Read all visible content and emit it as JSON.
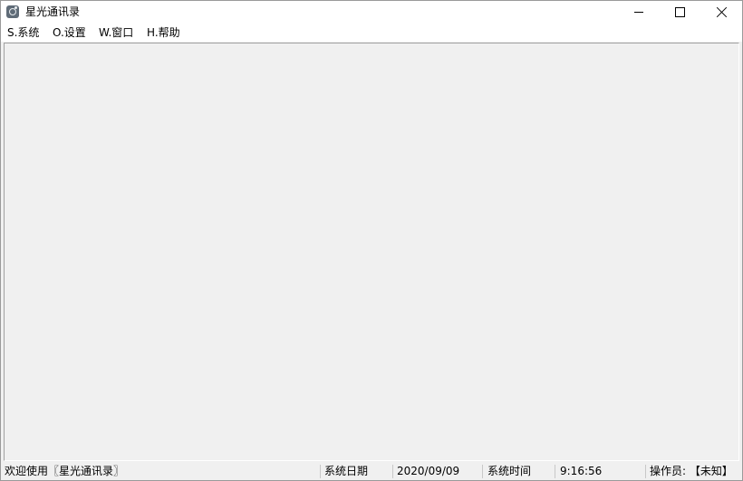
{
  "window": {
    "title": "星光通讯录",
    "icon": "app-icon",
    "controls": {
      "minimize": "minimize-icon",
      "maximize": "maximize-icon",
      "close": "close-icon"
    }
  },
  "menu": {
    "items": [
      {
        "label": "S.系统"
      },
      {
        "label": "O.设置"
      },
      {
        "label": "W.窗口"
      },
      {
        "label": "H.帮助"
      }
    ]
  },
  "statusbar": {
    "welcome": "欢迎使用〖星光通讯录〗",
    "date_label": "系统日期",
    "date_value": "2020/09/09",
    "time_label": "系统时间",
    "time_value": "9:16:56",
    "operator": "操作员: 【未知】"
  },
  "colors": {
    "client_background": "#f0f0f0",
    "titlebar_background": "#ffffff"
  }
}
